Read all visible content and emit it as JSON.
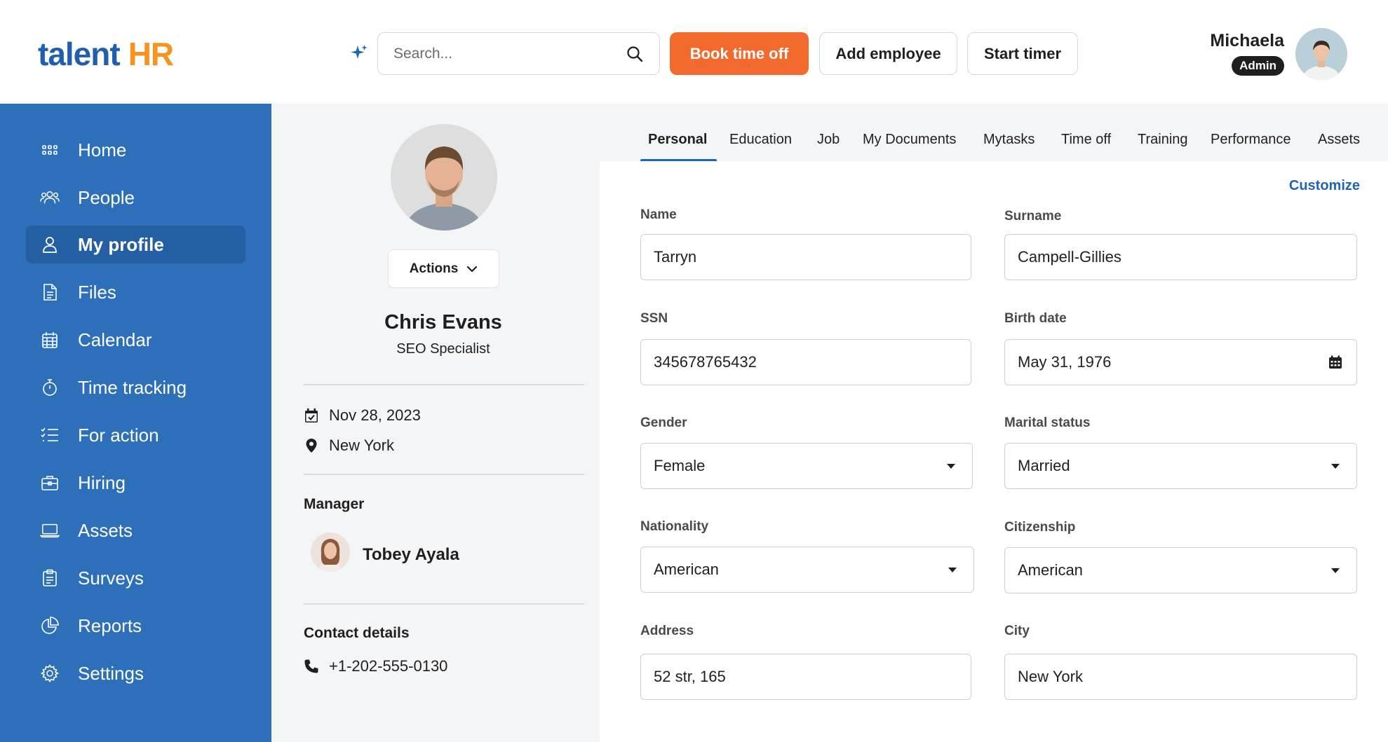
{
  "header": {
    "logo_part1": "talent",
    "logo_part2": "HR",
    "search_placeholder": "Search...",
    "book_time_off": "Book time off",
    "add_employee": "Add employee",
    "start_timer": "Start timer",
    "user_name": "Michaela",
    "user_role": "Admin"
  },
  "sidebar": {
    "items": [
      {
        "label": "Home",
        "icon": "grid-icon"
      },
      {
        "label": "People",
        "icon": "people-icon"
      },
      {
        "label": "My profile",
        "icon": "user-icon",
        "active": true
      },
      {
        "label": "Files",
        "icon": "file-icon"
      },
      {
        "label": "Calendar",
        "icon": "calendar-icon"
      },
      {
        "label": "Time tracking",
        "icon": "stopwatch-icon"
      },
      {
        "label": "For action",
        "icon": "checklist-icon"
      },
      {
        "label": "Hiring",
        "icon": "briefcase-icon"
      },
      {
        "label": "Assets",
        "icon": "laptop-icon"
      },
      {
        "label": "Surveys",
        "icon": "clipboard-icon"
      },
      {
        "label": "Reports",
        "icon": "pie-chart-icon"
      },
      {
        "label": "Settings",
        "icon": "gear-icon"
      }
    ]
  },
  "profile": {
    "actions_label": "Actions",
    "name": "Chris Evans",
    "title": "SEO Specialist",
    "date": "Nov 28, 2023",
    "location": "New York",
    "manager_label": "Manager",
    "manager_name": "Tobey Ayala",
    "contact_label": "Contact details",
    "phone": "+1-202-555-0130"
  },
  "tabs": [
    {
      "label": "Personal",
      "active": true
    },
    {
      "label": "Education"
    },
    {
      "label": "Job"
    },
    {
      "label": "My Documents"
    },
    {
      "label": "Mytasks"
    },
    {
      "label": "Time off"
    },
    {
      "label": "Training"
    },
    {
      "label": "Performance"
    },
    {
      "label": "Assets"
    }
  ],
  "form": {
    "customize_label": "Customize",
    "name_label": "Name",
    "name_value": "Tarryn",
    "surname_label": "Surname",
    "surname_value": "Campell-Gillies",
    "ssn_label": "SSN",
    "ssn_value": "345678765432",
    "birth_label": "Birth date",
    "birth_value": "May 31, 1976",
    "gender_label": "Gender",
    "gender_value": "Female",
    "marital_label": "Marital status",
    "marital_value": "Married",
    "nationality_label": "Nationality",
    "nationality_value": "American",
    "citizenship_label": "Citizenship",
    "citizenship_value": "American",
    "address_label": "Address",
    "address_value": "52 str, 165",
    "city_label": "City",
    "city_value": "New York"
  },
  "colors": {
    "sidebar": "#2d6fb8",
    "sidebar_active": "#245fa3",
    "primary_button": "#f26a2e",
    "accent_blue": "#1f64b5",
    "logo_blue": "#1f5fae",
    "logo_orange": "#f7941d"
  }
}
